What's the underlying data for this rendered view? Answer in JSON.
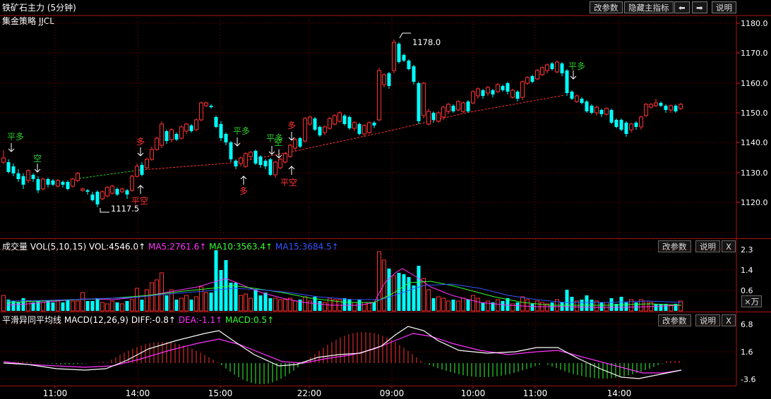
{
  "title": "铁矿石主力 (5分钟)",
  "strategy_label": "集金策略 JJCL",
  "toolbar": {
    "params": "改参数",
    "hide_main": "隐藏主指标",
    "back_arrow": "⬅",
    "fwd_arrow": "➡",
    "help": "说明"
  },
  "price_axis": [
    "1180.0",
    "1170.0",
    "1160.0",
    "1150.0",
    "1140.0",
    "1130.0",
    "1120.0"
  ],
  "price_annotations": {
    "high": "1178.0",
    "low": "1117.5"
  },
  "signals": [
    {
      "text": "平多",
      "color": "#2ecc2e"
    },
    {
      "text": "空",
      "color": "#2ecc2e"
    },
    {
      "text": "多",
      "color": "#ff3333"
    },
    {
      "text": "平空",
      "color": "#ff3333"
    },
    {
      "text": "平多",
      "color": "#2ecc2e"
    },
    {
      "text": "多",
      "color": "#ff3333"
    },
    {
      "text": "平多",
      "color": "#2ecc2e"
    },
    {
      "text": "空",
      "color": "#2ecc2e"
    },
    {
      "text": "多",
      "color": "#ff3333"
    },
    {
      "text": "平空",
      "color": "#ff3333"
    },
    {
      "text": "平多",
      "color": "#2ecc2e"
    }
  ],
  "volume": {
    "label": "成交量",
    "params": "VOL(5,10,15)",
    "vol": "VOL:4546.0↑",
    "ma5": "MA5:2761.6↑",
    "ma10": "MA10:3563.4↑",
    "ma15": "MA15:3684.5↑",
    "btn_params": "改参数",
    "btn_help": "说明",
    "btn_close": "X",
    "axis": [
      "2.3",
      "1.4",
      "0.6"
    ],
    "unit_button": "×万"
  },
  "macd": {
    "label": "平滑异同平均线",
    "params": "MACD(12,26,9)",
    "diff": "DIFF:-0.8↑",
    "dea": "DEA:-1.1↑",
    "macd": "MACD:0.5↑",
    "btn_params": "改参数",
    "btn_help": "说明",
    "btn_close": "X",
    "axis": [
      "6.8",
      "1.6",
      "-3.6"
    ]
  },
  "time_axis": [
    "11:00",
    "14:00",
    "15:00",
    "22:00",
    "09:00",
    "10:00",
    "11:00",
    "14:00"
  ],
  "colors": {
    "up": "#ff3232",
    "down": "#00ffff",
    "ma5": "#ff33ff",
    "ma10": "#33ff33",
    "ma15": "#3355ff",
    "grid": "#8b0000"
  }
}
